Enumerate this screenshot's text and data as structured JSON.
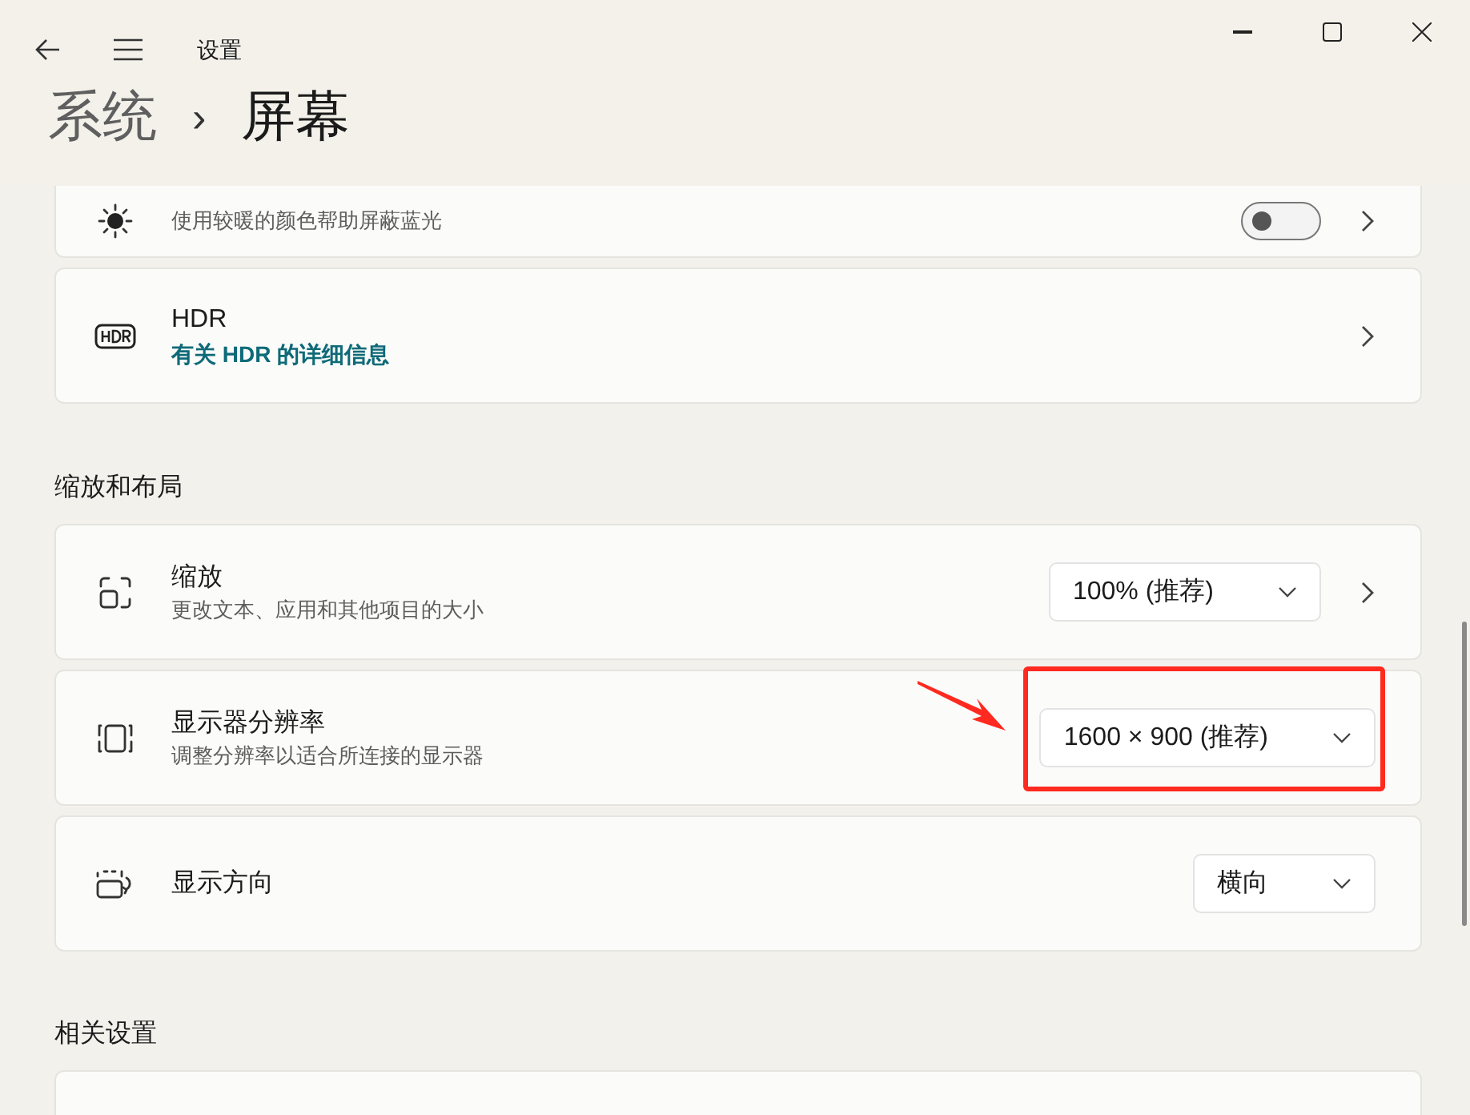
{
  "window": {
    "title": "设置"
  },
  "breadcrumb": {
    "parent": "系统",
    "separator": "›",
    "current": "屏幕"
  },
  "top_cards": [
    {
      "kind": "toggle",
      "description": "使用较暖的颜色帮助屏蔽蓝光",
      "on": false,
      "chevron": true
    },
    {
      "kind": "link",
      "title": "HDR",
      "link": "有关 HDR 的详细信息",
      "chevron": true
    }
  ],
  "sections": [
    {
      "heading": "缩放和布局",
      "cards": [
        {
          "kind": "dropdown",
          "title": "缩放",
          "description": "更改文本、应用和其他项目的大小",
          "value": "100% (推荐)",
          "chevron": true,
          "highlighted": false
        },
        {
          "kind": "dropdown",
          "title": "显示器分辨率",
          "description": "调整分辨率以适合所连接的显示器",
          "value": "1600 × 900 (推荐)",
          "chevron": false,
          "highlighted": true
        },
        {
          "kind": "dropdown",
          "title": "显示方向",
          "value": "横向",
          "chevron": false,
          "highlighted": false
        }
      ]
    },
    {
      "heading": "相关设置",
      "cards": [
        {
          "kind": "cut"
        }
      ]
    }
  ]
}
